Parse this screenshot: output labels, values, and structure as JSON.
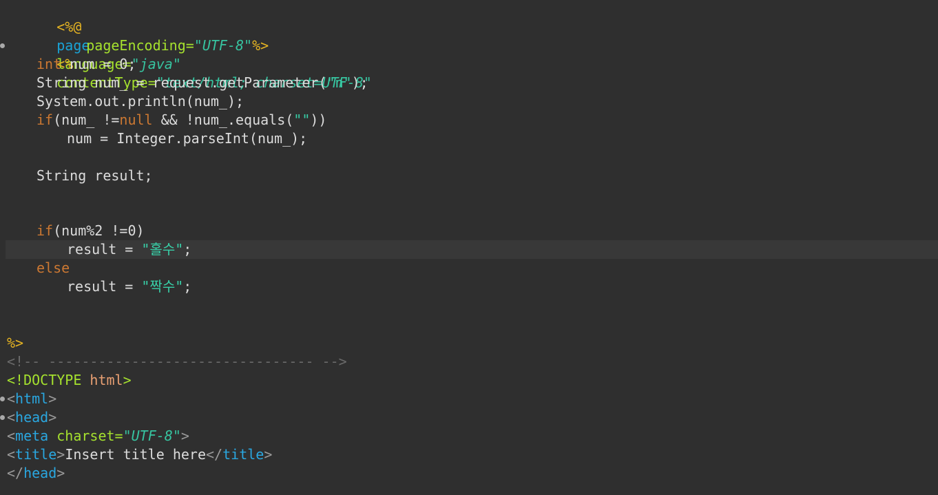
{
  "editor": {
    "lines": {
      "l1": {
        "open": "<%@",
        "directive": "page",
        "attr1": "language",
        "eq1": "=",
        "val1": "\"java\"",
        "attr2": "contentType",
        "eq2": "=",
        "val2": "\"text/html; charset=UTF-8\""
      },
      "l2": {
        "attr": "pageEncoding",
        "eq": "=",
        "val": "\"UTF-8\"",
        "close": "%>"
      },
      "l3": {
        "open": "<%"
      },
      "l4": {
        "kw": "int",
        "rest": " num = 0;"
      },
      "l5": {
        "a": "String num_ = request.getParameter(",
        "str": "\"n\"",
        "b": ");"
      },
      "l6": {
        "text": "System.out.println(num_);"
      },
      "l7": {
        "kw1": "if",
        "a": "(num_ !=",
        "kw2": "null",
        "b": " && !num_.equals(",
        "str": "\"\"",
        "c": "))"
      },
      "l8": {
        "text": "num = Integer.parseInt(num_);"
      },
      "l10": {
        "text": "String result;"
      },
      "l13": {
        "kw": "if",
        "rest": "(num%2 !=0)"
      },
      "l14": {
        "a": "result = ",
        "str": "\"홀수\"",
        "b": ";"
      },
      "l15": {
        "kw": "else"
      },
      "l16": {
        "a": "result = ",
        "str": "\"짝수\"",
        "b": ";"
      },
      "l19": {
        "close": "%>"
      },
      "l20": {
        "comment": "<!-- -------------------------------- -->"
      },
      "l21": {
        "open": "<!DOCTYPE",
        "name": " html",
        "close": ">"
      },
      "l22": {
        "lt": "<",
        "tag": "html",
        "gt": ">"
      },
      "l23": {
        "lt": "<",
        "tag": "head",
        "gt": ">"
      },
      "l24": {
        "lt": "<",
        "tag": "meta",
        "attr": " charset",
        "eq": "=",
        "val": "\"UTF-8\"",
        "gt": ">"
      },
      "l25": {
        "lt": "<",
        "tag": "title",
        "gt": ">",
        "text": "Insert title here",
        "lt2": "</",
        "tag2": "title",
        "gt2": ">"
      },
      "l26": {
        "lt": "</",
        "tag": "head",
        "gt": ">"
      }
    }
  }
}
